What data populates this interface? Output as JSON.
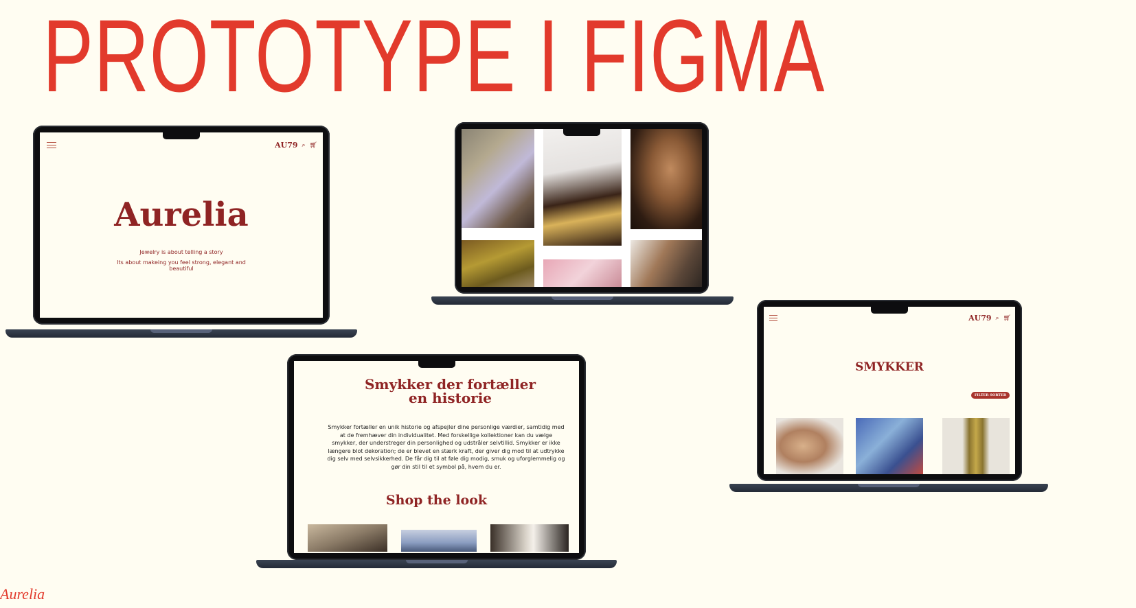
{
  "slide": {
    "title": "PROTOTYPE I FIGMA",
    "footer_brand": "Aurelia"
  },
  "laptop1": {
    "logo": "AU79",
    "brand": "Aurelia",
    "tagline1": "Jewelry is about telling a story",
    "tagline2": "Its about makeing you feel strong, elegant and beautiful"
  },
  "laptop3": {
    "heading": "Smykker der fortæller en historie",
    "body": "Smykker fortæller en unik historie og afspejler dine personlige værdier, samtidig med at de fremhæver din individualitet. Med forskellige kollektioner kan du vælge smykker, der understreger din personlighed og udstråler selvtillid. Smykker er ikke længere blot dekoration; de er blevet en stærk kraft, der giver dig mod til at udtrykke dig selv med selvsikkerhed. De får dig til at føle dig modig, smuk og uforglemmelig og gør din stil til et symbol på, hvem du er.",
    "shop_heading": "Shop the look"
  },
  "laptop4": {
    "logo": "AU79",
    "heading": "SMYKKER",
    "filter_label": "FILTER SORTER"
  },
  "icons": [
    "hamburger-icon",
    "search-icon",
    "cart-icon"
  ],
  "colors": {
    "accent": "#e23a2c",
    "brand": "#8f2424",
    "background": "#fffdf2"
  }
}
